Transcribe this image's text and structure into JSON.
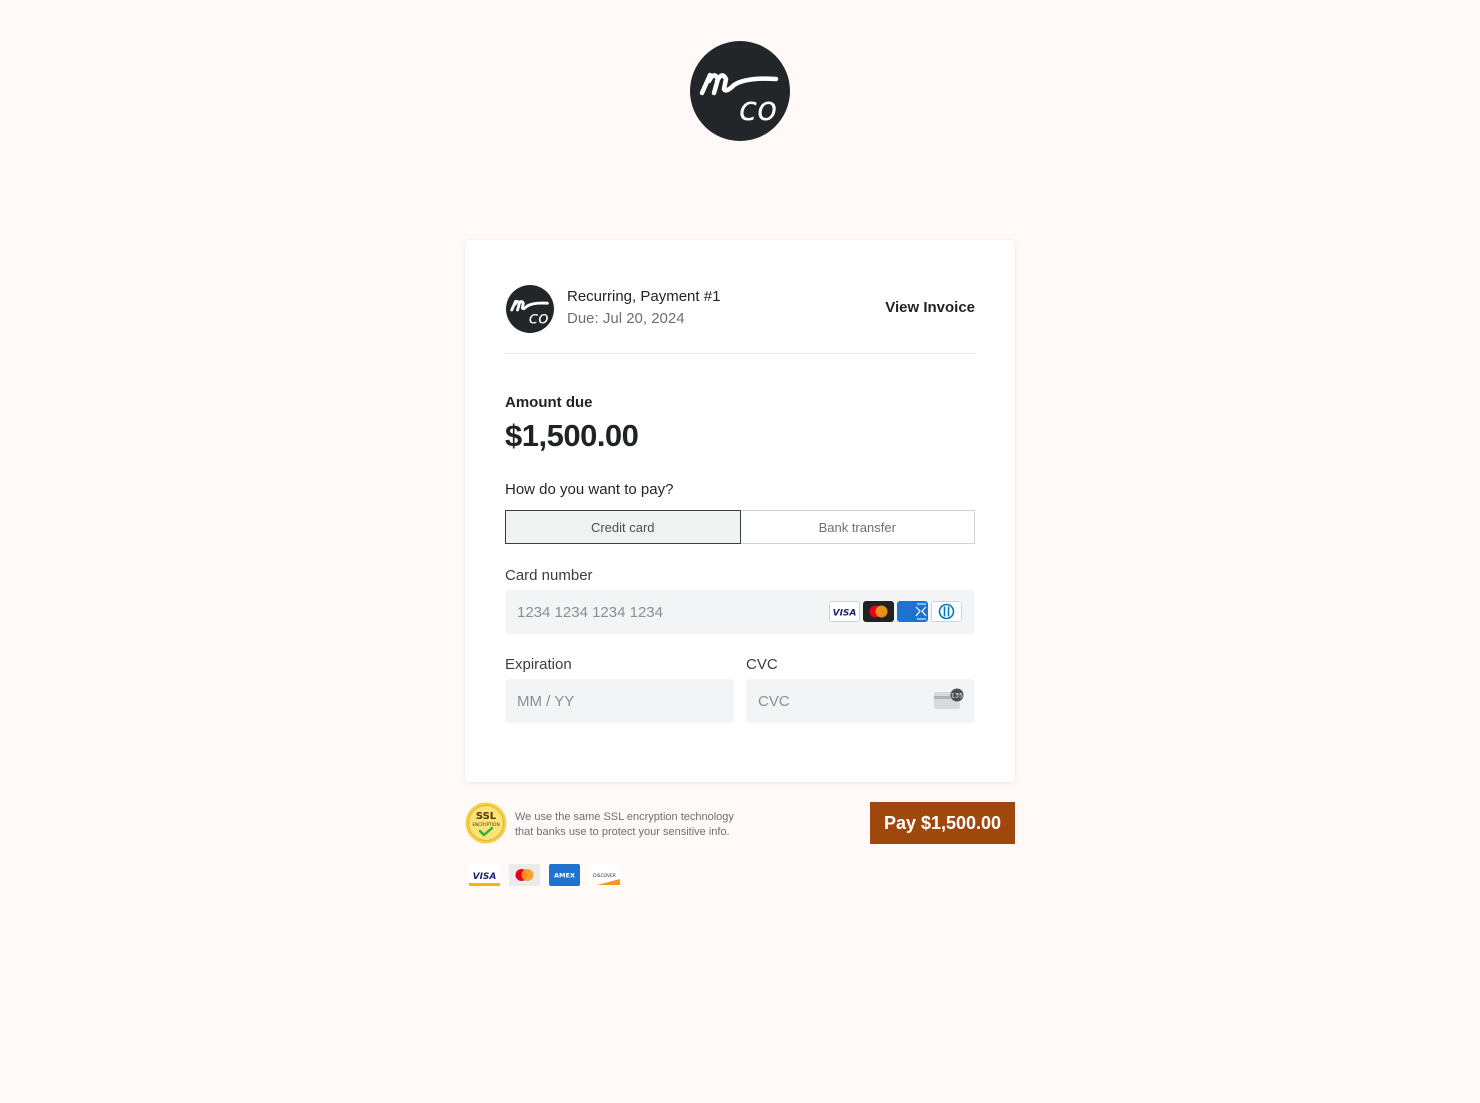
{
  "brand": {
    "logo_name": "mco-logo"
  },
  "invoice": {
    "title": "Recurring, Payment #1",
    "due": "Due: Jul 20, 2024",
    "view_invoice": "View Invoice"
  },
  "amount": {
    "label": "Amount due",
    "value": "$1,500.00"
  },
  "payment": {
    "question": "How do you want to pay?",
    "methods": [
      {
        "label": "Credit card",
        "selected": true
      },
      {
        "label": "Bank transfer",
        "selected": false
      }
    ]
  },
  "form": {
    "card_number": {
      "label": "Card number",
      "placeholder": "1234 1234 1234 1234"
    },
    "expiration": {
      "label": "Expiration",
      "placeholder": "MM / YY"
    },
    "cvc": {
      "label": "CVC",
      "placeholder": "CVC"
    }
  },
  "card_brands": [
    "visa",
    "mastercard",
    "amex",
    "diners"
  ],
  "security": {
    "seal_top": "SSL",
    "seal_bottom": "ENCRYPTION",
    "line1": "We use the same SSL encryption technology",
    "line2": "that banks use to protect your sensitive info."
  },
  "pay_button": "Pay $1,500.00",
  "footer_brands": {
    "visa": "VISA",
    "amex": "AMEX",
    "discover": "DISCOVER"
  },
  "colors": {
    "pay_button": "#a0470d",
    "page_bg": "#fffaf7",
    "logo_bg": "#232629"
  }
}
